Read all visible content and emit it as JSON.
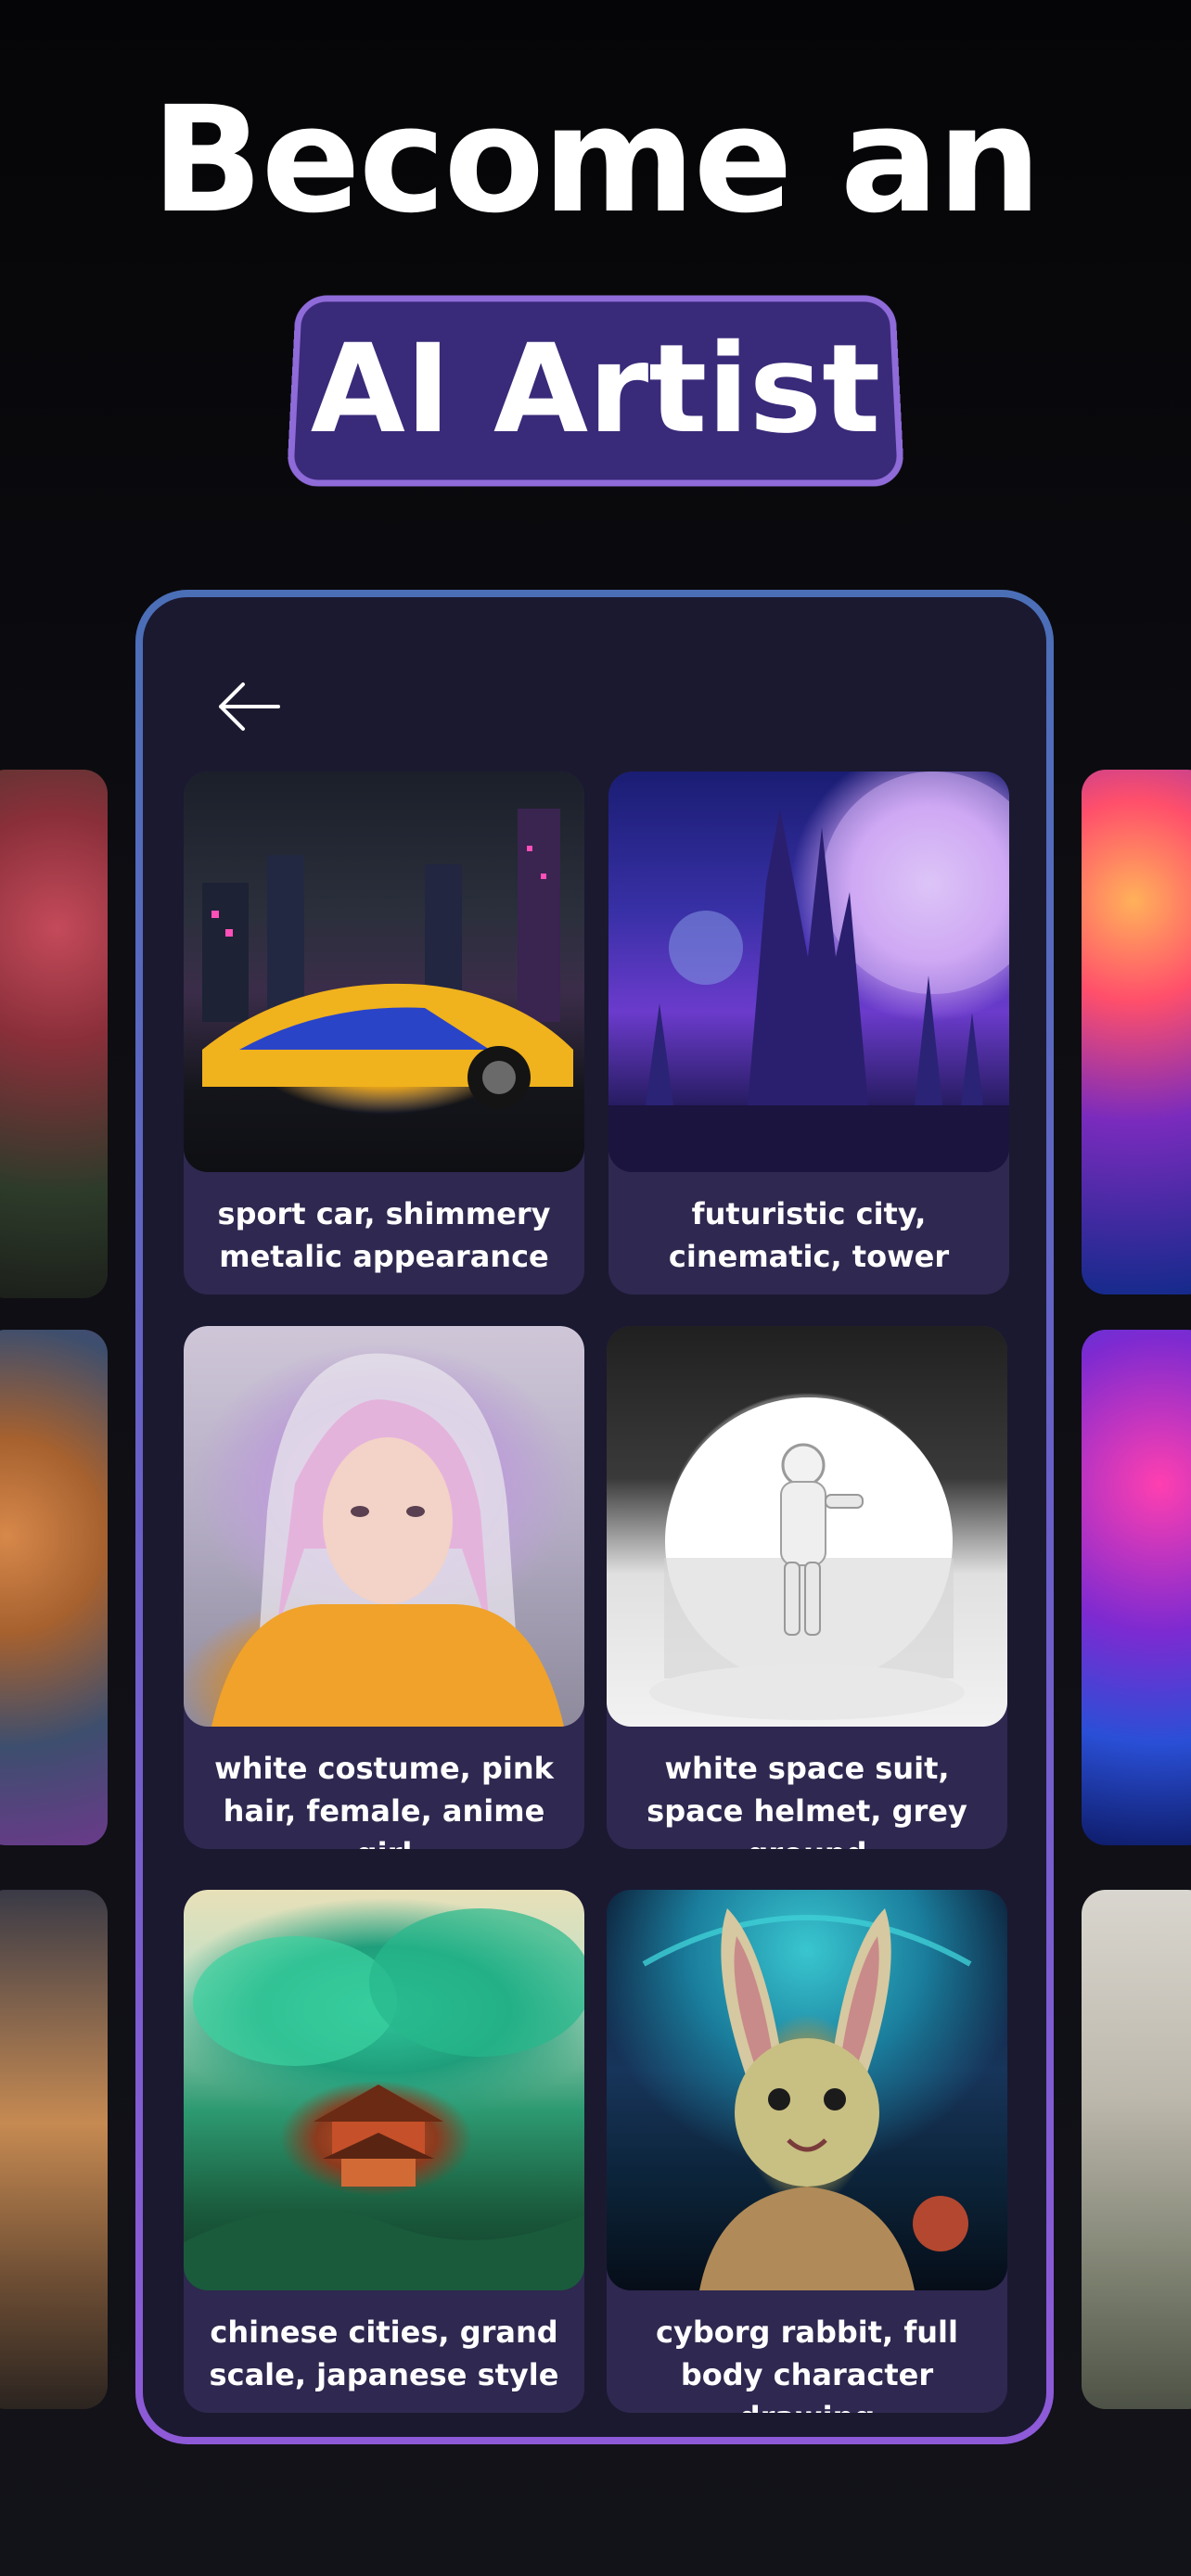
{
  "header": {
    "headline": "Become an",
    "badge": "AI Artist"
  },
  "phone": {
    "back_icon": "arrow-left-icon"
  },
  "cards": [
    {
      "caption": "sport car, shimmery metalic appearance"
    },
    {
      "caption": "futuristic city, cinematic, tower"
    },
    {
      "caption": "white costume, pink hair, female, anime girl"
    },
    {
      "caption": "white space suit, space helmet, grey ground"
    },
    {
      "caption": "chinese cities, grand scale, japanese style"
    },
    {
      "caption": "cyborg rabbit, full body character drawing"
    }
  ],
  "colors": {
    "background": "#0c0c10",
    "badge_fill": "#3a2a7a",
    "badge_border": "#8f6bd9",
    "phone_fill": "#1b1930",
    "card_fill": "#2f2850"
  }
}
